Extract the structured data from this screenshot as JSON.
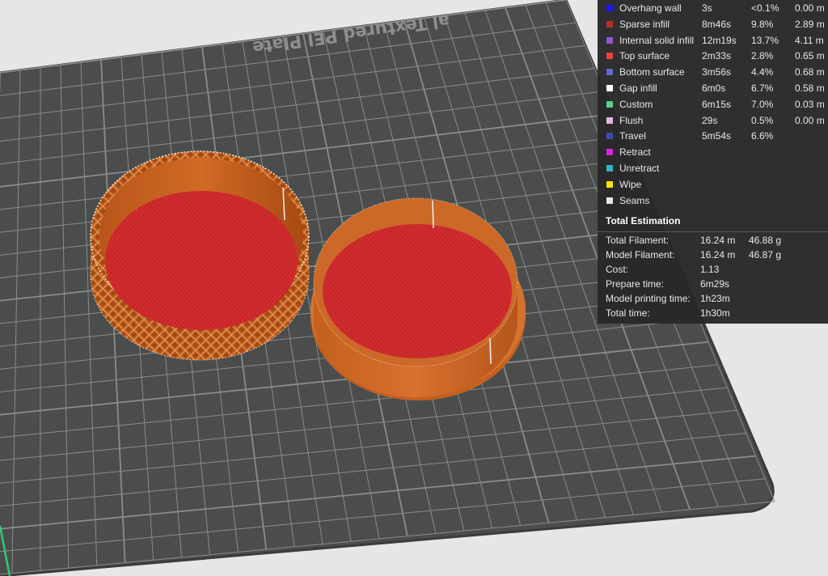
{
  "plate": {
    "label": "al Textured PEI Plate"
  },
  "legend": {
    "features": [
      {
        "name": "Overhang wall",
        "time": "3s",
        "percent": "<0.1%",
        "length": "0.00 m",
        "color": "#1a1aff"
      },
      {
        "name": "Sparse infill",
        "time": "8m46s",
        "percent": "9.8%",
        "length": "2.89 m",
        "color": "#b03029"
      },
      {
        "name": "Internal solid infill",
        "time": "12m19s",
        "percent": "13.7%",
        "length": "4.11 m",
        "color": "#9654cc"
      },
      {
        "name": "Top surface",
        "time": "2m33s",
        "percent": "2.8%",
        "length": "0.65 m",
        "color": "#f04040"
      },
      {
        "name": "Bottom surface",
        "time": "3m56s",
        "percent": "4.4%",
        "length": "0.68 m",
        "color": "#6666cc"
      },
      {
        "name": "Gap infill",
        "time": "6m0s",
        "percent": "6.7%",
        "length": "0.58 m",
        "color": "#ffffff"
      },
      {
        "name": "Custom",
        "time": "6m15s",
        "percent": "7.0%",
        "length": "0.03 m",
        "color": "#5dcc8c"
      },
      {
        "name": "Flush",
        "time": "29s",
        "percent": "0.5%",
        "length": "0.00 m",
        "color": "#e6b3e6"
      },
      {
        "name": "Travel",
        "time": "5m54s",
        "percent": "6.6%",
        "length": "",
        "color": "#3b4da8"
      },
      {
        "name": "Retract",
        "time": "",
        "percent": "",
        "length": "",
        "color": "#d926d9"
      },
      {
        "name": "Unretract",
        "time": "",
        "percent": "",
        "length": "",
        "color": "#33b2cc"
      },
      {
        "name": "Wipe",
        "time": "",
        "percent": "",
        "length": "",
        "color": "#ffe600"
      },
      {
        "name": "Seams",
        "time": "",
        "percent": "",
        "length": "",
        "color": "#e6e6e6"
      }
    ]
  },
  "total": {
    "title": "Total Estimation",
    "rows": [
      {
        "label": "Total Filament:",
        "v1": "16.24 m",
        "v2": "46.88 g"
      },
      {
        "label": "Model Filament:",
        "v1": "16.24 m",
        "v2": "46.87 g"
      },
      {
        "label": "Cost:",
        "v1": "1.13",
        "v2": ""
      },
      {
        "label": "Prepare time:",
        "v1": "6m29s",
        "v2": ""
      },
      {
        "label": "Model printing time:",
        "v1": "1h23m",
        "v2": ""
      },
      {
        "label": "Total time:",
        "v1": "1h30m",
        "v2": ""
      }
    ]
  }
}
